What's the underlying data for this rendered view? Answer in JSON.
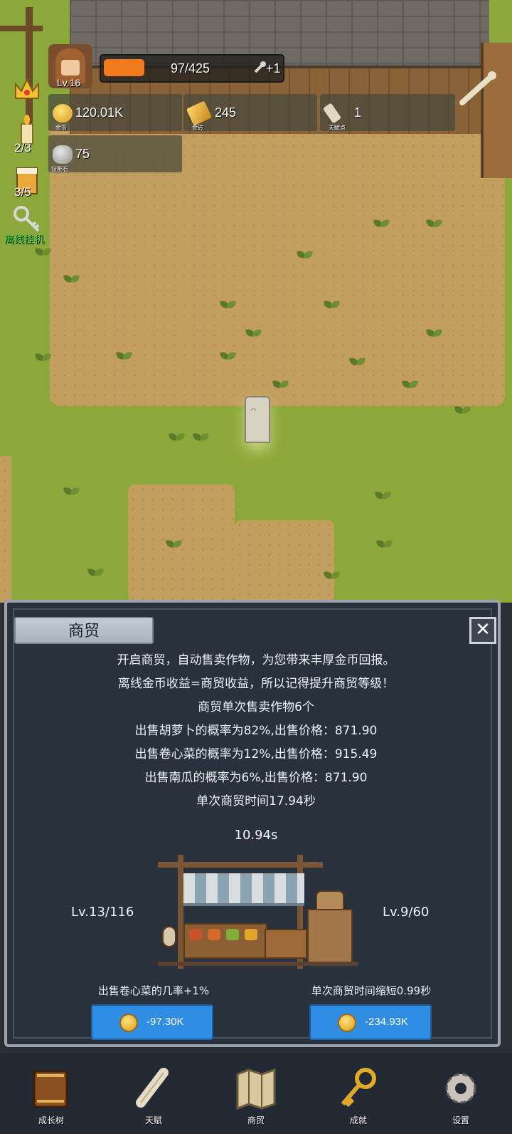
{
  "hud": {
    "level": "Lv.16",
    "exp_text": "97/425",
    "exp_progress": 0.23,
    "exp_bonus": "+1",
    "gold_value": "120.01K",
    "gold_caption": "金币",
    "goldbar_value": "245",
    "goldbar_caption": "金砖",
    "talent_value": "1",
    "talent_caption": "天赋点",
    "skillstone_value": "75",
    "skillstone_caption": "技能石",
    "candle_count": "2/3",
    "beer_count": "3/5",
    "idle_label": "离线挂机"
  },
  "panel": {
    "title": "商贸",
    "close_icon": "close-x-icon",
    "lines": [
      "开启商贸，自动售卖作物，为您带来丰厚金币回报。",
      "离线金币收益=商贸收益，所以记得提升商贸等级！",
      "商贸单次售卖作物6个",
      "出售胡萝卜的概率为82%,出售价格：871.90",
      "出售卷心菜的概率为12%,出售价格：915.49",
      "出售南瓜的概率为6%,出售价格：871.90",
      "单次商贸时间17.94秒"
    ],
    "timer": "10.94s",
    "left_level": "Lv.13/116",
    "right_level": "Lv.9/60",
    "left_upgrade_desc": "出售卷心菜的几率+1%",
    "right_upgrade_desc": "单次商贸时间缩短0.99秒",
    "left_cost": "-97.30K",
    "right_cost": "-234.93K"
  },
  "nav": [
    {
      "label": "成长树",
      "icon": "book-icon"
    },
    {
      "label": "天赋",
      "icon": "scroll-icon"
    },
    {
      "label": "商贸",
      "icon": "map-icon"
    },
    {
      "label": "成就",
      "icon": "key-icon"
    },
    {
      "label": "设置",
      "icon": "gear-icon"
    }
  ],
  "colors": {
    "button_blue": "#2f8de3",
    "exp_orange": "#f27a1c",
    "panel_bg": "#29313c",
    "idle_green": "#3fdc3f"
  }
}
